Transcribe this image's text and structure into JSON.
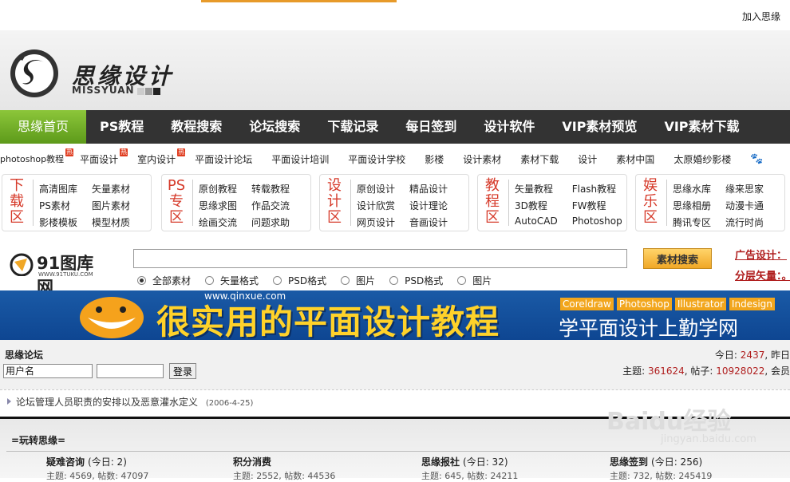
{
  "topbar": {
    "join": "加入思缘"
  },
  "header": {
    "brand": "思缘设计",
    "brand_sub": "MISSYUAN"
  },
  "mainnav": [
    "思缘首页",
    "PS教程",
    "教程搜索",
    "论坛搜索",
    "下载记录",
    "每日签到",
    "设计软件",
    "VIP素材预览",
    "VIP素材下载"
  ],
  "subnav": [
    {
      "label": "photoshop教程",
      "hot": true
    },
    {
      "label": "平面设计",
      "hot": true
    },
    {
      "label": "室内设计",
      "hot": true
    },
    {
      "label": "平面设计论坛",
      "hot": false
    },
    {
      "label": "平面设计培训",
      "hot": false
    },
    {
      "label": "平面设计学校",
      "hot": false
    },
    {
      "label": "影楼",
      "hot": false
    },
    {
      "label": "设计素材",
      "hot": false
    },
    {
      "label": "素材下载",
      "hot": false
    },
    {
      "label": "设计",
      "hot": false
    },
    {
      "label": "素材中国",
      "hot": false
    },
    {
      "label": "太原婚纱影楼",
      "hot": false
    }
  ],
  "hot_badge": "热",
  "zones": [
    {
      "title": [
        "下",
        "载",
        "区"
      ],
      "links": [
        "高清图库",
        "矢量素材",
        "PS素材",
        "图片素材",
        "影楼模板",
        "模型材质"
      ]
    },
    {
      "title": [
        "PS",
        "专",
        "区"
      ],
      "links": [
        "原创教程",
        "转载教程",
        "思缘求图",
        "作品交流",
        "绘画交流",
        "问题求助"
      ]
    },
    {
      "title": [
        "设",
        "计",
        "区"
      ],
      "links": [
        "原创设计",
        "精品设计",
        "设计欣赏",
        "设计理论",
        "网页设计",
        "音画设计"
      ]
    },
    {
      "title": [
        "教",
        "程",
        "区"
      ],
      "links": [
        "矢量教程",
        "Flash教程",
        "3D教程",
        "FW教程",
        "AutoCAD",
        "Photoshop"
      ]
    },
    {
      "title": [
        "娱",
        "乐",
        "区"
      ],
      "links": [
        "思缘水库",
        "缘来思家",
        "思缘相册",
        "动漫卡通",
        "腾讯专区",
        "流行时尚"
      ]
    }
  ],
  "search": {
    "logo_text": "91图库网",
    "logo_sub": "WWW.91TUKU.COM",
    "button": "素材搜索",
    "radios": [
      "全部素材",
      "矢量格式",
      "PSD格式",
      "图片",
      "PSD格式",
      "图片"
    ],
    "selected_radio": 0,
    "ad_links": [
      "广告设计：",
      "分层矢量：。"
    ]
  },
  "banner": {
    "url": "www.qinxue.com",
    "headline": "很实用的平面设计教程",
    "tags": [
      "Coreldraw",
      "Photoshop",
      "Illustrator",
      "Indesign"
    ],
    "slogan": "学平面设计上勤学网"
  },
  "forum": {
    "title": "思缘论坛",
    "username_value": "用户名",
    "login": "登录",
    "today_label": "今日:",
    "today_value": "2437",
    "yesterday_label": "昨日",
    "topics_label": "主题:",
    "topics_value": "361624",
    "posts_label": "帖子:",
    "posts_value": "10928022",
    "members_label": "会员"
  },
  "notice": {
    "text": "论坛管理人员职责的安排以及恶意灌水定义",
    "date": "(2006-4-25)"
  },
  "category": {
    "title": "=玩转思缘=",
    "forums": [
      {
        "name": "疑难咨询",
        "today": "(今日: 2)",
        "stats": "主题: 4569, 帖数: 47097"
      },
      {
        "name": "积分消费",
        "today": "",
        "stats": "主题: 2552, 帖数: 44536"
      },
      {
        "name": "思缘报社",
        "today": "(今日: 32)",
        "stats": "主题: 645, 帖数: 24211"
      },
      {
        "name": "思缘签到",
        "today": "(今日: 256)",
        "stats": "主题: 732, 帖数: 245419"
      }
    ]
  },
  "watermark": {
    "text": "Baidu经验",
    "sub": "jingyan.baidu.com"
  },
  "colors": {
    "nav_bg": "#333333",
    "nav_active": "#6aa824",
    "zone_title": "#d63a2a",
    "banner_bg": "#1a5aa6",
    "accent_red": "#b01f1f"
  }
}
